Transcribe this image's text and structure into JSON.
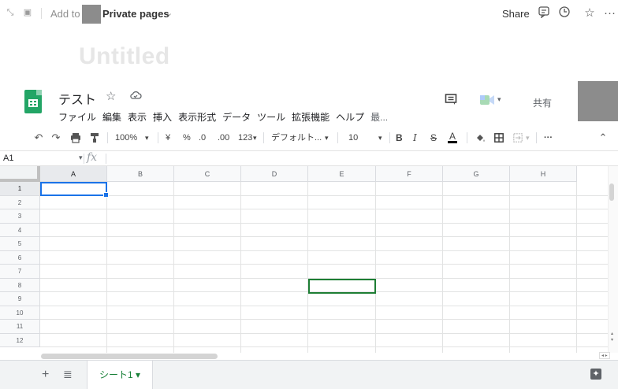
{
  "notion_topbar": {
    "add_to_label": "Add to",
    "workspace_name": "Private pages",
    "share_label": "Share"
  },
  "page": {
    "title": "Untitled"
  },
  "sheet": {
    "doc_title": "テスト",
    "menu": [
      "ファイル",
      "編集",
      "表示",
      "挿入",
      "表示形式",
      "データ",
      "ツール",
      "拡張機能",
      "ヘルプ",
      "最..."
    ],
    "share_button_label": "共有"
  },
  "toolbar": {
    "zoom": "100%",
    "currency": "¥",
    "percent": "%",
    "decimal_decrease": ".0",
    "decimal_increase": ".00",
    "number_format": "123",
    "font_family": "デフォルト...",
    "font_size": "10",
    "bold": "B",
    "italic": "I",
    "strike": "S",
    "text_color": "A",
    "more": "···"
  },
  "formula_bar": {
    "cell_ref": "A1",
    "fx_label": "fx"
  },
  "grid": {
    "columns": [
      "A",
      "B",
      "C",
      "D",
      "E",
      "F",
      "G",
      "H"
    ],
    "rows": [
      "1",
      "2",
      "3",
      "4",
      "5",
      "6",
      "7",
      "8",
      "9",
      "10",
      "11",
      "12"
    ]
  },
  "sheets_bar": {
    "add_label": "+",
    "active_tab": "シート1 ▾"
  }
}
